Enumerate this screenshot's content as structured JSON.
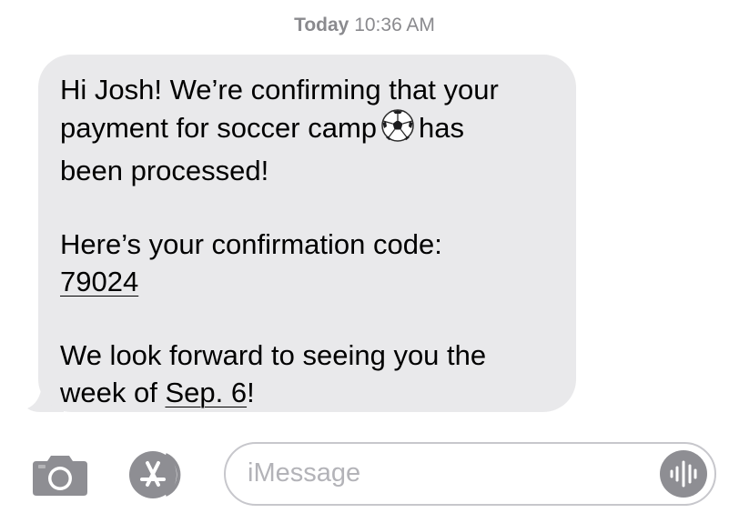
{
  "timestamp": {
    "day": "Today",
    "time": "10:36 AM"
  },
  "message": {
    "line1": "Hi Josh! We’re confirming that your",
    "line2_before_emoji": "payment for soccer camp",
    "emoji": "soccer-ball-icon",
    "line2_after_emoji": "has",
    "line3": "been processed!",
    "line4": "Here’s your confirmation code:",
    "confirmation_code": "79024",
    "line6": "We look forward to seeing you the",
    "line7_before_date": "week of ",
    "date_link": "Sep. 6",
    "line7_after_date": "!"
  },
  "input_bar": {
    "camera_icon": "camera-icon",
    "apps_icon": "app-store-icon",
    "placeholder": "iMessage",
    "audio_icon": "audio-waveform-icon"
  },
  "colors": {
    "bubble_background": "#e9e9eb",
    "timestamp_text": "#8a8a8e",
    "icon_gray": "#8e8e93",
    "field_border": "#c7c7cc"
  }
}
